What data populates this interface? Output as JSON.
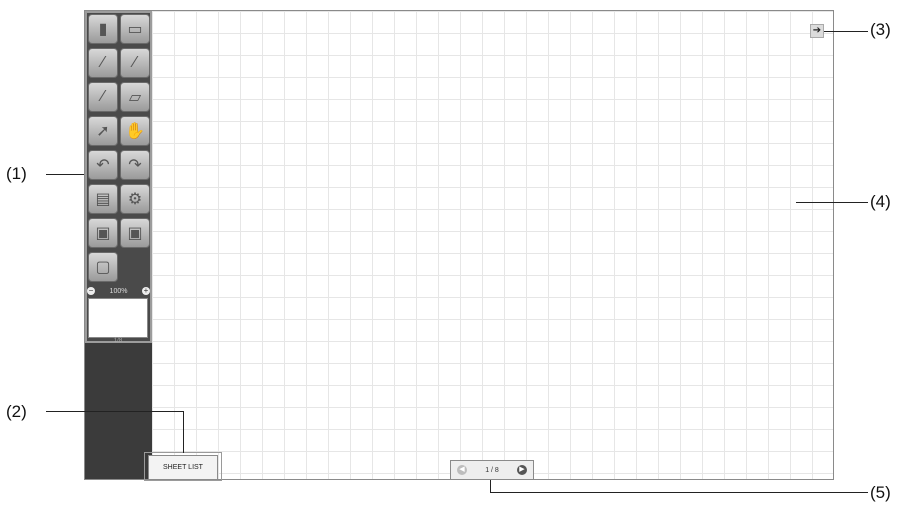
{
  "callouts": {
    "c1": "(1)",
    "c2": "(2)",
    "c3": "(3)",
    "c4": "(4)",
    "c5": "(5)"
  },
  "toolbox": {
    "tools": [
      {
        "name": "pen-color-icon",
        "glyph": "▮"
      },
      {
        "name": "open-folder-icon",
        "glyph": "▭"
      },
      {
        "name": "pen-icon",
        "glyph": "∕"
      },
      {
        "name": "marker-icon",
        "glyph": "∕"
      },
      {
        "name": "highlighter-icon",
        "glyph": "∕"
      },
      {
        "name": "eraser-icon",
        "glyph": "▱"
      },
      {
        "name": "select-arrow-icon",
        "glyph": "➚"
      },
      {
        "name": "hand-icon",
        "glyph": "✋"
      },
      {
        "name": "undo-icon",
        "glyph": "↶"
      },
      {
        "name": "redo-icon",
        "glyph": "↷"
      },
      {
        "name": "save-icon",
        "glyph": "▤"
      },
      {
        "name": "settings-gear-icon",
        "glyph": "⚙"
      },
      {
        "name": "print-icon",
        "glyph": "▣"
      },
      {
        "name": "print-all-icon",
        "glyph": "▣"
      },
      {
        "name": "screen-capture-icon",
        "glyph": "▢"
      }
    ],
    "zoom": {
      "minus": "−",
      "plus": "+",
      "level": "100%"
    },
    "preview_page": "1/8"
  },
  "sheet_list": {
    "label": "SHEET LIST"
  },
  "pager": {
    "prev": "◀",
    "next": "▶",
    "page_text": "1 / 8"
  },
  "hide_button": {
    "glyph": "➔"
  }
}
